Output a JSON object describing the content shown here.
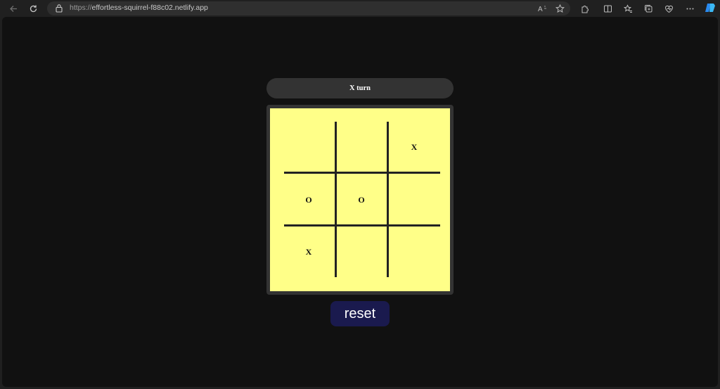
{
  "browser": {
    "url_scheme": "https://",
    "url_host": "effortless-squirrel-f88c02.netlify.app"
  },
  "game": {
    "status": "X turn",
    "cells": [
      "",
      "",
      "X",
      "O",
      "O",
      "",
      "X",
      "",
      ""
    ],
    "reset_label": "reset"
  },
  "colors": {
    "board": "#ffff88",
    "frame": "#333333",
    "reset_button": "#1a1a4e",
    "page_background": "#111111"
  }
}
